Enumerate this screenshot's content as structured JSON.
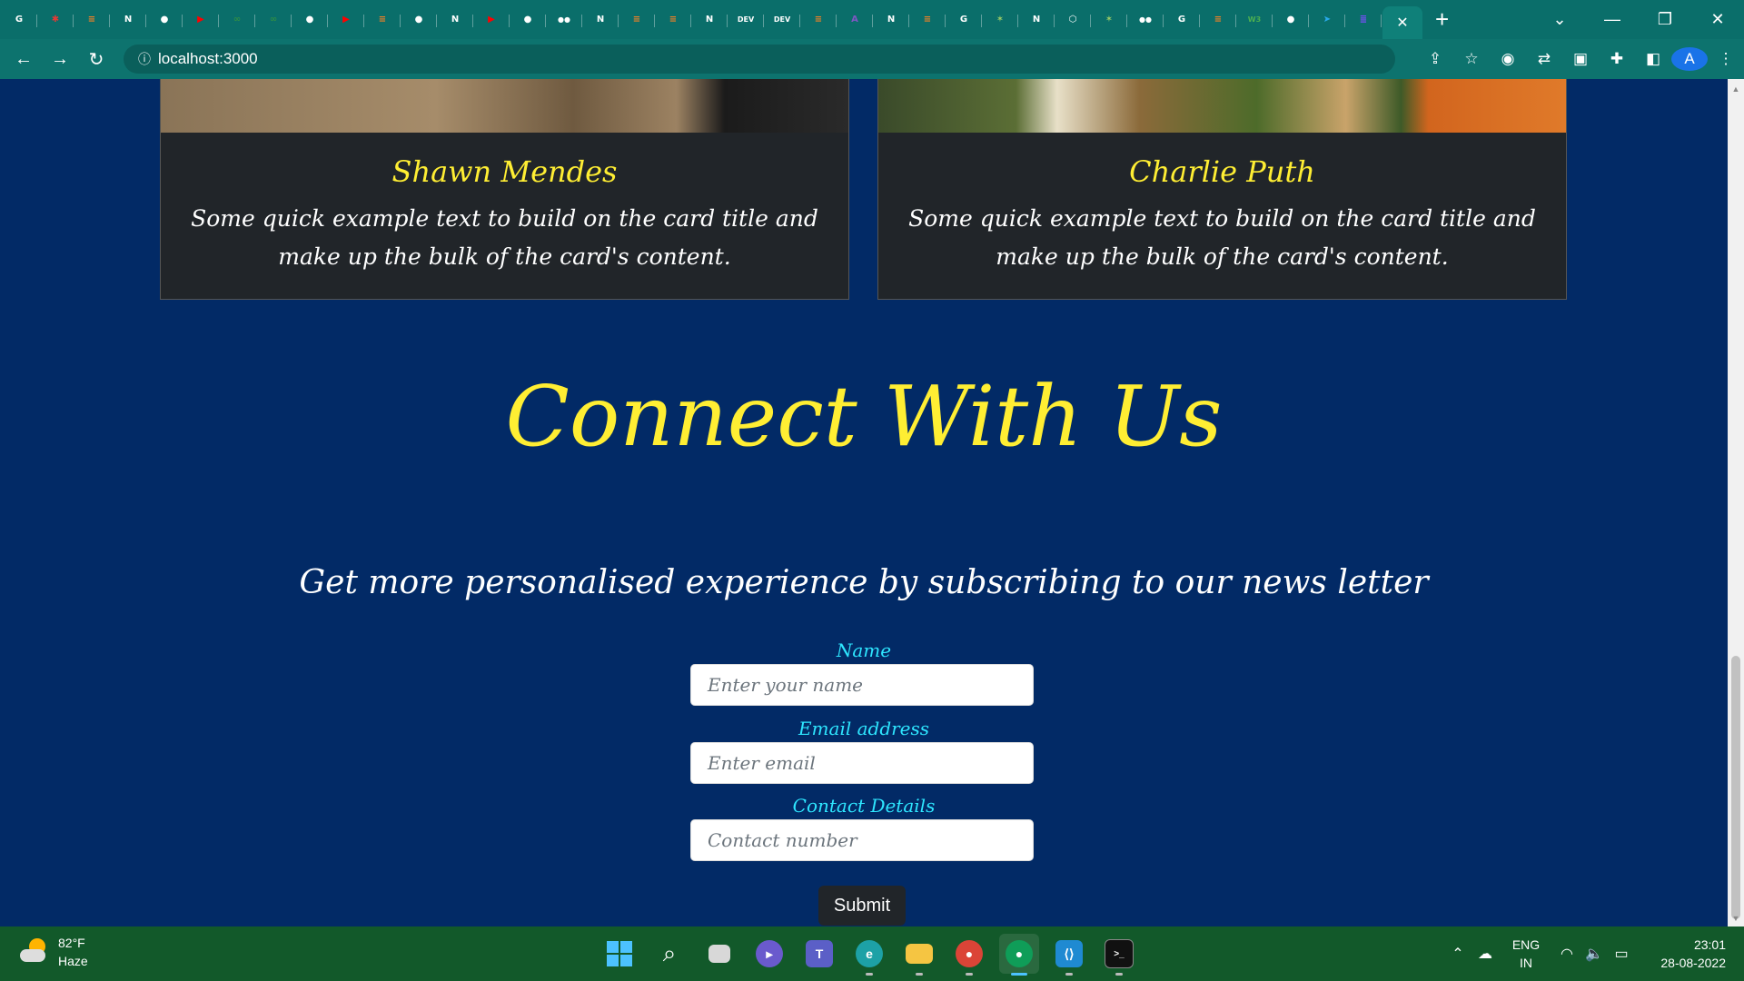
{
  "browser": {
    "url": "localhost:3000",
    "tabs": [
      {
        "icon": "google-icon",
        "color": "#ffffff",
        "glyph": "G"
      },
      {
        "icon": "gear-icon",
        "color": "#e53935",
        "glyph": "✱"
      },
      {
        "icon": "stackoverflow-icon",
        "color": "#f48024",
        "glyph": "≡"
      },
      {
        "icon": "notion-icon",
        "color": "#ffffff",
        "glyph": "N"
      },
      {
        "icon": "github-icon",
        "color": "#ffffff",
        "glyph": "●"
      },
      {
        "icon": "youtube-icon",
        "color": "#ff0000",
        "glyph": "▶"
      },
      {
        "icon": "geeksforgeeks-icon",
        "color": "#2f8d46",
        "glyph": "∞"
      },
      {
        "icon": "geeksforgeeks-icon",
        "color": "#2f8d46",
        "glyph": "∞"
      },
      {
        "icon": "github-icon",
        "color": "#ffffff",
        "glyph": "●"
      },
      {
        "icon": "youtube-icon",
        "color": "#ff0000",
        "glyph": "▶"
      },
      {
        "icon": "stackoverflow-icon",
        "color": "#f48024",
        "glyph": "≡"
      },
      {
        "icon": "github-icon",
        "color": "#ffffff",
        "glyph": "●"
      },
      {
        "icon": "notion-icon",
        "color": "#ffffff",
        "glyph": "N"
      },
      {
        "icon": "youtube-icon",
        "color": "#ff0000",
        "glyph": "▶"
      },
      {
        "icon": "github-icon",
        "color": "#ffffff",
        "glyph": "●"
      },
      {
        "icon": "medium-icon",
        "color": "#ffffff",
        "glyph": "●●"
      },
      {
        "icon": "notion-icon",
        "color": "#ffffff",
        "glyph": "N"
      },
      {
        "icon": "stackoverflow-icon",
        "color": "#f48024",
        "glyph": "≡"
      },
      {
        "icon": "stackoverflow-icon",
        "color": "#f48024",
        "glyph": "≡"
      },
      {
        "icon": "notion-icon",
        "color": "#ffffff",
        "glyph": "N"
      },
      {
        "icon": "dev-icon",
        "color": "#ffffff",
        "glyph": "DEV"
      },
      {
        "icon": "dev-icon",
        "color": "#ffffff",
        "glyph": "DEV"
      },
      {
        "icon": "stackoverflow-icon",
        "color": "#f48024",
        "glyph": "≡"
      },
      {
        "icon": "apollo-icon",
        "color": "#7e57c2",
        "glyph": "A"
      },
      {
        "icon": "notion-icon",
        "color": "#ffffff",
        "glyph": "N"
      },
      {
        "icon": "stackoverflow-icon",
        "color": "#f48024",
        "glyph": "≡"
      },
      {
        "icon": "google-icon",
        "color": "#ffffff",
        "glyph": "G"
      },
      {
        "icon": "sparkle-icon",
        "color": "#9ccc65",
        "glyph": "✶"
      },
      {
        "icon": "notion-icon",
        "color": "#ffffff",
        "glyph": "N"
      },
      {
        "icon": "cube-icon",
        "color": "#ffffff",
        "glyph": "⬡"
      },
      {
        "icon": "sparkle-icon",
        "color": "#9ccc65",
        "glyph": "✶"
      },
      {
        "icon": "medium-icon",
        "color": "#ffffff",
        "glyph": "●●"
      },
      {
        "icon": "google-icon",
        "color": "#ffffff",
        "glyph": "G"
      },
      {
        "icon": "stackoverflow-icon",
        "color": "#f48024",
        "glyph": "≡"
      },
      {
        "icon": "w3-icon",
        "color": "#4caf50",
        "glyph": "W3"
      },
      {
        "icon": "github-icon",
        "color": "#ffffff",
        "glyph": "●"
      },
      {
        "icon": "telegram-icon",
        "color": "#29a9eb",
        "glyph": "➤"
      },
      {
        "icon": "list-icon",
        "color": "#7c4dff",
        "glyph": "≣"
      }
    ],
    "active_tab_close": "✕",
    "new_tab": "+",
    "profile_initial": "A"
  },
  "cards": [
    {
      "title": "Shawn Mendes",
      "text": "Some quick example text to build on the card title and make up the bulk of the card's content."
    },
    {
      "title": "Charlie Puth",
      "text": "Some quick example text to build on the card title and make up the bulk of the card's content."
    }
  ],
  "connect": {
    "heading": "Connect With Us",
    "subtitle": "Get more personalised experience by subscribing to our news letter"
  },
  "form": {
    "name_label": "Name",
    "name_placeholder": "Enter your name",
    "email_label": "Email address",
    "email_placeholder": "Enter email",
    "contact_label": "Contact Details",
    "contact_placeholder": "Contact number",
    "submit_label": "Submit"
  },
  "taskbar": {
    "temperature": "82°F",
    "condition": "Haze",
    "lang_line1": "ENG",
    "lang_line2": "IN",
    "time": "23:01",
    "date": "28-08-2022"
  },
  "colors": {
    "page_bg": "#022a66",
    "card_bg": "#212529",
    "heading_yellow": "#ffee33",
    "label_cyan": "#2ee6ff"
  }
}
